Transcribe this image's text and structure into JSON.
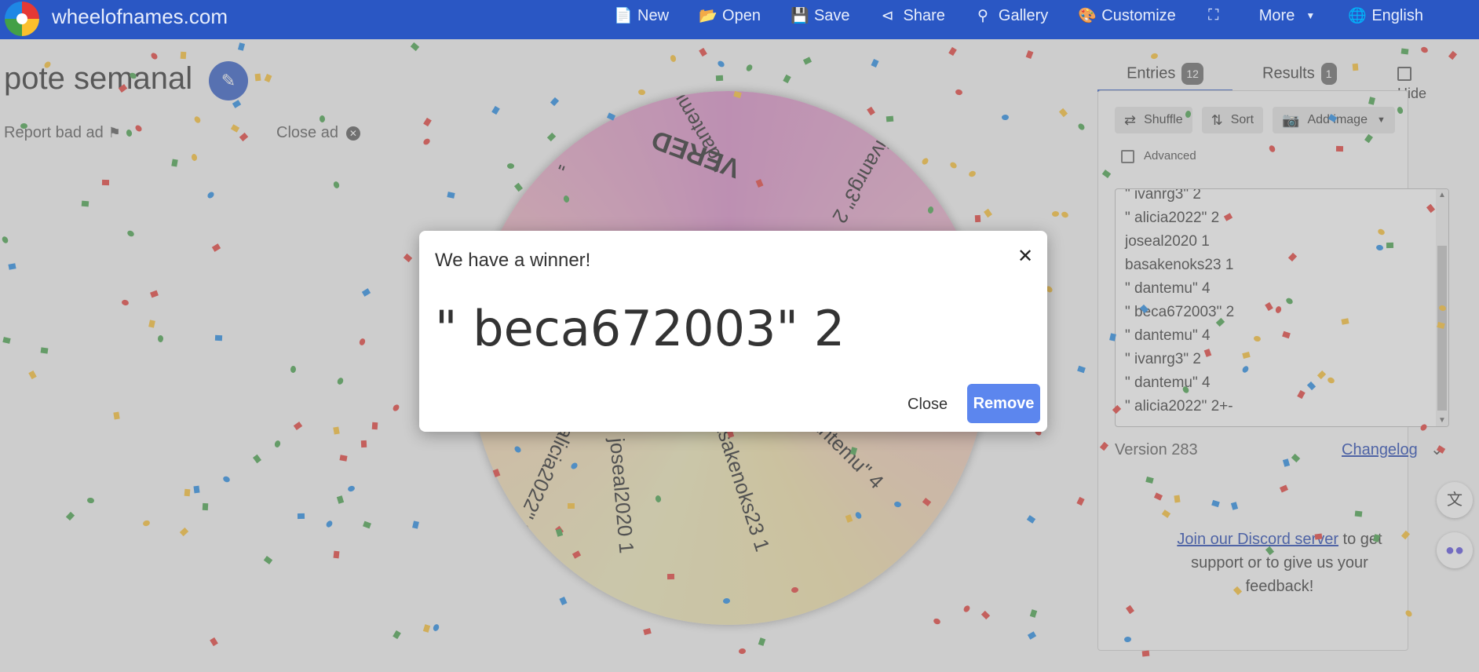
{
  "header": {
    "site_name": "wheelofnames.com",
    "menu": [
      {
        "label": "New",
        "icon": "file-icon"
      },
      {
        "label": "Open",
        "icon": "folder-icon"
      },
      {
        "label": "Save",
        "icon": "save-icon"
      },
      {
        "label": "Share",
        "icon": "share-icon"
      },
      {
        "label": "Gallery",
        "icon": "search-icon"
      },
      {
        "label": "Customize",
        "icon": "palette-icon"
      },
      {
        "label": "",
        "icon": "fullscreen-icon"
      },
      {
        "label": "More",
        "icon": "chevron-down-icon"
      },
      {
        "label": "English",
        "icon": "globe-icon"
      }
    ]
  },
  "wheel": {
    "title": "pote semanal",
    "report_ad": "Report bad ad",
    "close_ad": "Close ad",
    "slice_labels": [
      "\" dantemu\" 4",
      "ivanrg3\" 2",
      "dantemu\" 4",
      "basakenoks23 1",
      "joseal2020 1",
      "alicia2022\" 2",
      "VERED",
      "\" dantemu\" 4"
    ]
  },
  "sidebar": {
    "tab_entries": "Entries",
    "entries_count": "12",
    "tab_results": "Results",
    "results_count": "1",
    "hide_label": "Hide",
    "shuffle_label": "Shuffle",
    "sort_label": "Sort",
    "add_image_label": "Add image",
    "advanced_label": "Advanced",
    "entries": [
      "\" ivanrg3\" 2",
      "\" alicia2022\" 2",
      "joseal2020 1",
      "basakenoks23 1",
      "\" dantemu\" 4",
      "\" beca672003\" 2",
      "\" dantemu\" 4",
      "\" ivanrg3\" 2",
      "\" dantemu\" 4",
      "\" alicia2022\" 2+-"
    ],
    "version": "Version 283",
    "changelog": "Changelog",
    "discord_link": "Join our Discord server",
    "discord_text": " to get support or to give us your feedback!"
  },
  "modal": {
    "title": "We have a winner!",
    "winner": "\" beca672003\" 2",
    "close_label": "Close",
    "remove_label": "Remove"
  },
  "colors": {
    "header_bg": "#2a57c4",
    "remove_button": "#5c86ee",
    "link": "#1a3fb0"
  }
}
